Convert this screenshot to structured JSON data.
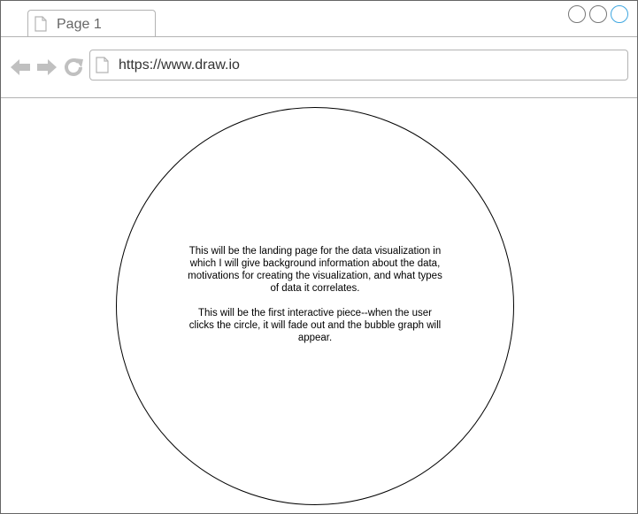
{
  "browser": {
    "tab": {
      "label": "Page 1",
      "icon": "document-icon"
    },
    "window_controls": [
      {
        "name": "window-button-1",
        "color": "#777777"
      },
      {
        "name": "window-button-2",
        "color": "#777777"
      },
      {
        "name": "window-button-3",
        "color": "#3fa7e0"
      }
    ],
    "nav": {
      "back_icon": "arrow-left-icon",
      "forward_icon": "arrow-right-icon",
      "refresh_icon": "refresh-icon"
    },
    "address_bar": {
      "url": "https://www.draw.io",
      "icon": "document-icon"
    }
  },
  "main": {
    "circle": {
      "paragraph_1": "This will be the landing page for the data visualization in which I will give background information about the data, motivations for creating the visualization, and what types of data it correlates.",
      "paragraph_2": "This will be the first interactive piece--when the user clicks the circle, it will fade out and the bubble graph will appear."
    }
  },
  "colors": {
    "chrome_border": "#b3b3b3",
    "icon_gray": "#c0c0c0",
    "accent_blue": "#3fa7e0"
  }
}
